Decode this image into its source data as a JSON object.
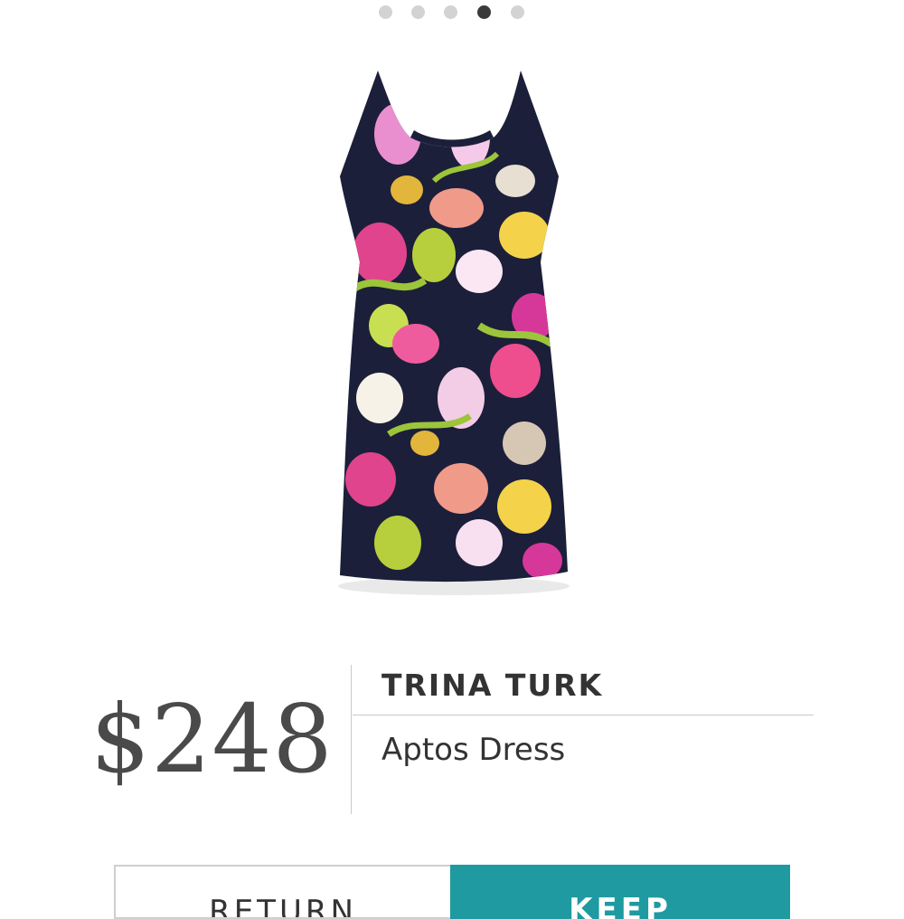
{
  "carousel": {
    "total": 5,
    "active_index": 3
  },
  "product": {
    "image_icon": "floral-halter-dress-image",
    "price": "$248",
    "brand": "TRINA TURK",
    "name": "Aptos Dress"
  },
  "actions": {
    "return_label": "RETURN",
    "keep_label": "KEEP"
  },
  "colors": {
    "accent": "#1e9aa0",
    "dot_active": "#3a3a3a",
    "dot_inactive": "#d3d3d3",
    "text": "#333333"
  }
}
